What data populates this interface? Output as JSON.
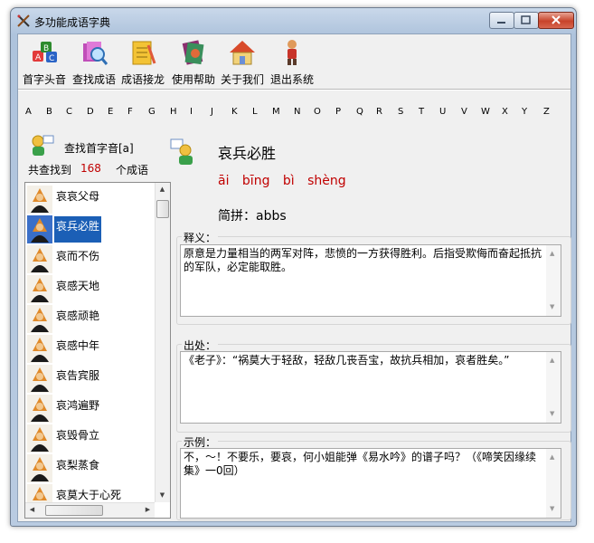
{
  "window": {
    "title": "多功能成语字典"
  },
  "toolbar": [
    {
      "label": "首字头音",
      "icon": "abc-letters-icon"
    },
    {
      "label": "查找成语",
      "icon": "magnifier-books-icon"
    },
    {
      "label": "成语接龙",
      "icon": "notepad-pencil-icon"
    },
    {
      "label": "使用帮助",
      "icon": "help-book-icon"
    },
    {
      "label": "关于我们",
      "icon": "home-icon"
    },
    {
      "label": "退出系统",
      "icon": "exit-person-icon"
    }
  ],
  "letters": [
    "A",
    "B",
    "C",
    "D",
    "E",
    "F",
    "G",
    "H",
    "I",
    "J",
    "K",
    "L",
    "M",
    "N",
    "O",
    "P",
    "Q",
    "R",
    "S",
    "T",
    "U",
    "V",
    "W",
    "X",
    "Y",
    "Z"
  ],
  "search": {
    "label": "查找首字音[a]",
    "found_prefix": "共查找到",
    "count": "168",
    "found_suffix": "个成语"
  },
  "idiom_list": [
    {
      "text": "哀哀父母"
    },
    {
      "text": "哀兵必胜",
      "selected": true
    },
    {
      "text": "哀而不伤"
    },
    {
      "text": "哀感天地"
    },
    {
      "text": "哀感顽艳"
    },
    {
      "text": "哀感中年"
    },
    {
      "text": "哀告宾服"
    },
    {
      "text": "哀鸿遍野"
    },
    {
      "text": "哀毁骨立"
    },
    {
      "text": "哀梨蒸食"
    },
    {
      "text": "哀莫大于心死"
    }
  ],
  "detail": {
    "title": "哀兵必胜",
    "pinyin": "āi bīng bì shèng",
    "abbr": "简拼：abbs",
    "meaning_label": "释义：",
    "meaning": "原意是力量相当的两军对阵，悲愤的一方获得胜利。后指受欺侮而奋起抵抗的军队，必定能取胜。",
    "source_label": "出处：",
    "source": "《老子》：“祸莫大于轻敌，轻敌几丧吾宝，故抗兵相加，哀者胜矣。”",
    "example_label": "示例：",
    "example": "不，～！不要乐，要哀，何小姐能弹《易水吟》的谱子吗？（《啼笑因缘续集》一0回）"
  },
  "colors": {
    "accent_red": "#c00000",
    "selection_blue": "#1b5fb6"
  }
}
